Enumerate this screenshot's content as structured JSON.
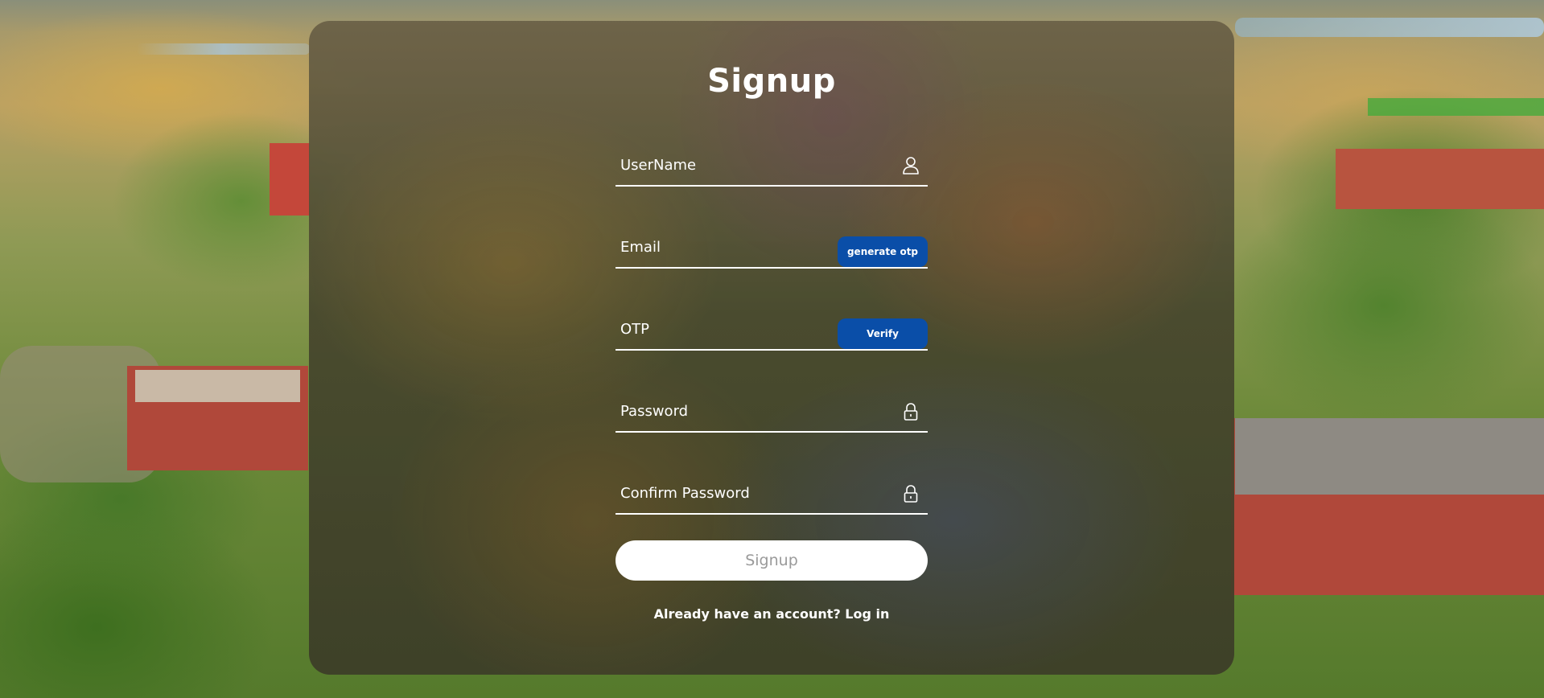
{
  "form": {
    "title": "Signup",
    "username": {
      "placeholder": "UserName",
      "value": "",
      "icon": "user-icon"
    },
    "email": {
      "placeholder": "Email",
      "value": "",
      "button_label": "generate otp"
    },
    "otp": {
      "placeholder": "OTP",
      "value": "",
      "button_label": "Verify"
    },
    "password": {
      "placeholder": "Password",
      "value": "",
      "icon": "lock-icon"
    },
    "confirm_password": {
      "placeholder": "Confirm Password",
      "value": "",
      "icon": "lock-icon"
    },
    "submit_label": "Signup",
    "footer_text": "Already have an account?",
    "login_link": "Log in"
  },
  "colors": {
    "accent_button": "#0a4ea8",
    "text": "#ffffff",
    "submit_text": "#9a9a9a"
  }
}
